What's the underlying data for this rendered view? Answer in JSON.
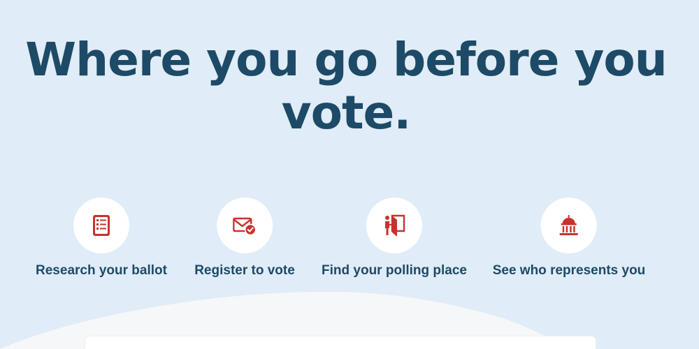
{
  "hero": {
    "headline": "Where you go before you vote."
  },
  "actions": [
    {
      "label": "Research your ballot",
      "icon": "ballot-checklist-icon"
    },
    {
      "label": "Register to vote",
      "icon": "envelope-check-icon"
    },
    {
      "label": "Find your polling place",
      "icon": "voting-booth-icon"
    },
    {
      "label": "See who represents you",
      "icon": "capitol-building-icon"
    }
  ],
  "colors": {
    "background": "#e0ecf7",
    "headline": "#1d4a66",
    "icon_red": "#c8322e",
    "circle": "#ffffff",
    "wave": "#f6f7f9"
  }
}
